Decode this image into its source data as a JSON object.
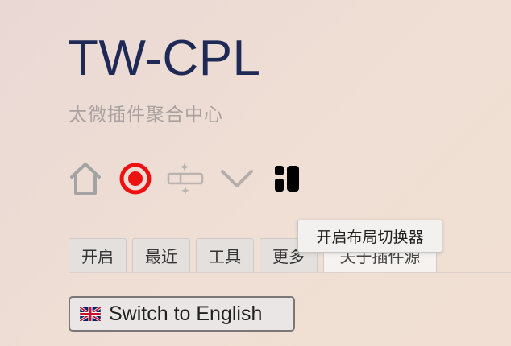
{
  "header": {
    "title": "TW-CPL",
    "subtitle": "太微插件聚合中心"
  },
  "toolbar": {
    "buttons": [
      {
        "icon": "home-icon"
      },
      {
        "icon": "record-icon",
        "color": "#ee1111"
      },
      {
        "icon": "tools-icon"
      },
      {
        "icon": "chevron-down-icon"
      },
      {
        "icon": "layout-switcher-icon"
      }
    ],
    "tooltip": "开启布局切换器"
  },
  "tabs": [
    {
      "label": "开启",
      "active": false
    },
    {
      "label": "最近",
      "active": false
    },
    {
      "label": "工具",
      "active": false
    },
    {
      "label": "更多",
      "active": false
    },
    {
      "label": "关于插件源",
      "active": true
    }
  ],
  "language_button": {
    "flag": "uk-flag-icon",
    "label": "Switch to English"
  },
  "colors": {
    "title": "#1e2a55",
    "subtitle": "#a9a1a0",
    "record_red": "#ee1111"
  }
}
